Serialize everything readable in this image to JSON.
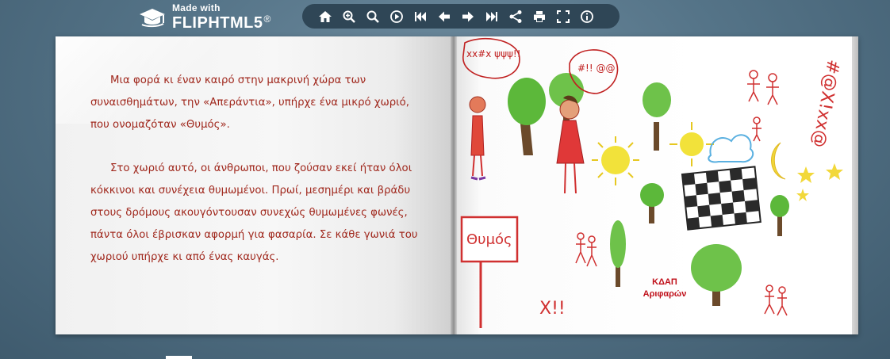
{
  "brand": {
    "made_with": "Made with",
    "name": "FLIPHTML5",
    "registered": "®"
  },
  "toolbar": {
    "buttons": [
      {
        "name": "home-icon"
      },
      {
        "name": "zoom-in-icon"
      },
      {
        "name": "search-icon"
      },
      {
        "name": "autoplay-icon"
      },
      {
        "name": "first-page-icon"
      },
      {
        "name": "previous-page-icon"
      },
      {
        "name": "next-page-icon"
      },
      {
        "name": "last-page-icon"
      },
      {
        "name": "share-icon"
      },
      {
        "name": "print-icon"
      },
      {
        "name": "fullscreen-icon"
      },
      {
        "name": "info-icon"
      }
    ]
  },
  "left_page": {
    "paragraphs": [
      "Μια φορά κι έναν καιρό στην μακρινή χώρα των συναισθημάτων, την «Απεράντια», υπήρχε ένα μικρό χωριό, που ονομαζόταν «Θυμός».",
      "Στο χωριό αυτό, οι άνθρωποι, που ζούσαν εκεί ήταν όλοι κόκκινοι και συνέχεια θυμωμένοι. Πρωί, μεσημέρι και βράδυ στους δρόμους ακουγόντουσαν συνεχώς θυμωμένες φωνές, πάντα όλοι έβρισκαν αφορμή για φασαρία. Σε κάθε γωνιά του χωριού υπήρχε κι από ένας καυγάς."
    ],
    "text_color": "#a0281d"
  },
  "right_page": {
    "sign_text": "Θυμός",
    "bubble_left": "xx#x ψψψ!!",
    "bubble_mid": "#!! @@",
    "side_scribble": "#@X!xx@",
    "bottom_scribble": "X!!",
    "caption_line1": "ΚΔΑΠ",
    "caption_line2": "Αριφαρών",
    "caption_color": "#c0101a"
  },
  "colors": {
    "background": "#557488",
    "toolbar": "#2f4656"
  }
}
